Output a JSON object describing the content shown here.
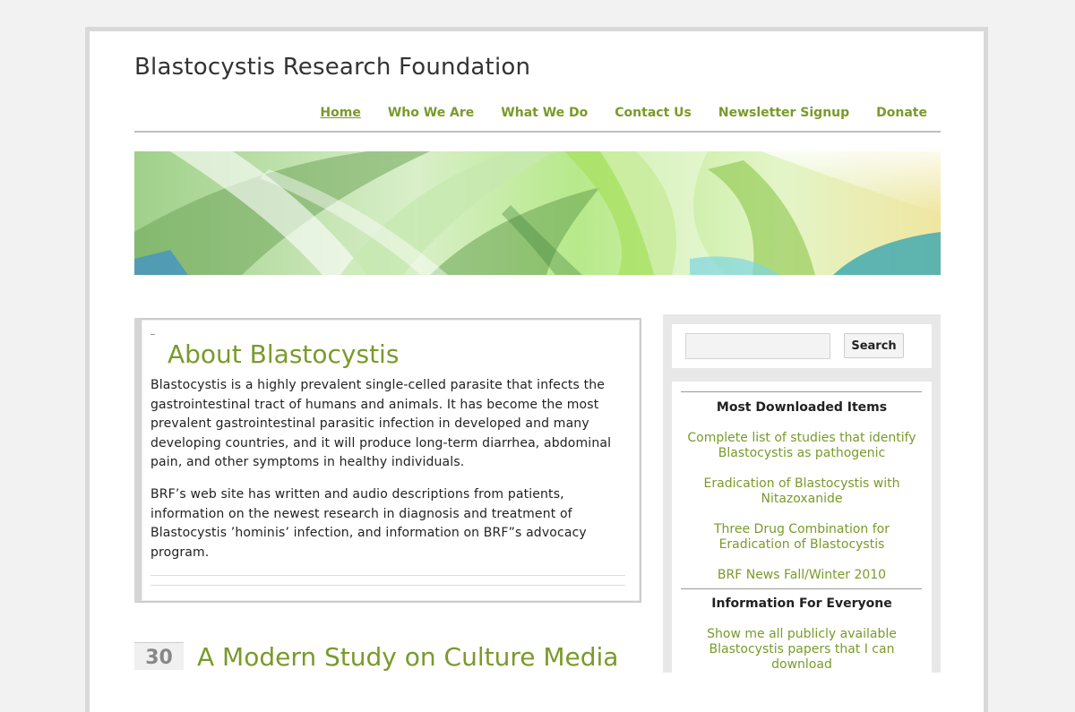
{
  "site": {
    "title": "Blastocystis Research Foundation"
  },
  "nav": {
    "items": [
      {
        "label": "Home"
      },
      {
        "label": "Who We Are"
      },
      {
        "label": "What We Do"
      },
      {
        "label": "Contact Us"
      },
      {
        "label": "Newsletter Signup"
      },
      {
        "label": "Donate"
      }
    ]
  },
  "about": {
    "title": "About Blastocystis",
    "paragraph1": "Blastocystis is a highly prevalent single-celled parasite that infects the gastrointestinal tract of humans and animals.  It has become the most prevalent gastrointestinal parasitic infection in developed and many developing countries, and it will produce long-term diarrhea, abdominal pain, and other symptoms in healthy individuals.",
    "paragraph2": "BRF’s web site has written and audio descriptions from patients, information on the newest research in diagnosis and treatment of Blastocystis ’hominis’ infection, and information on BRF”s advocacy program."
  },
  "post": {
    "date_day": "30",
    "title": "A Modern Study on Culture Media"
  },
  "search": {
    "placeholder": "",
    "button_label": "Search"
  },
  "most_downloaded": {
    "heading": "Most Downloaded  Items",
    "links": [
      {
        "label": "Complete list of studies that identify Blastocystis as pathogenic"
      },
      {
        "label": "Eradication of Blastocystis with Nitazoxanide"
      },
      {
        "label": "Three Drug Combination for Eradication of Blastocystis"
      },
      {
        "label": "BRF News Fall/Winter 2010"
      }
    ]
  },
  "info_everyone": {
    "heading": "Information For Everyone",
    "links": [
      {
        "label": "Show me all publicly available Blastocystis papers that I can download"
      }
    ]
  },
  "colors": {
    "accent": "#7a9a2a",
    "frame": "#d9d9d9",
    "sidebar_bg": "#e8e8e8"
  }
}
